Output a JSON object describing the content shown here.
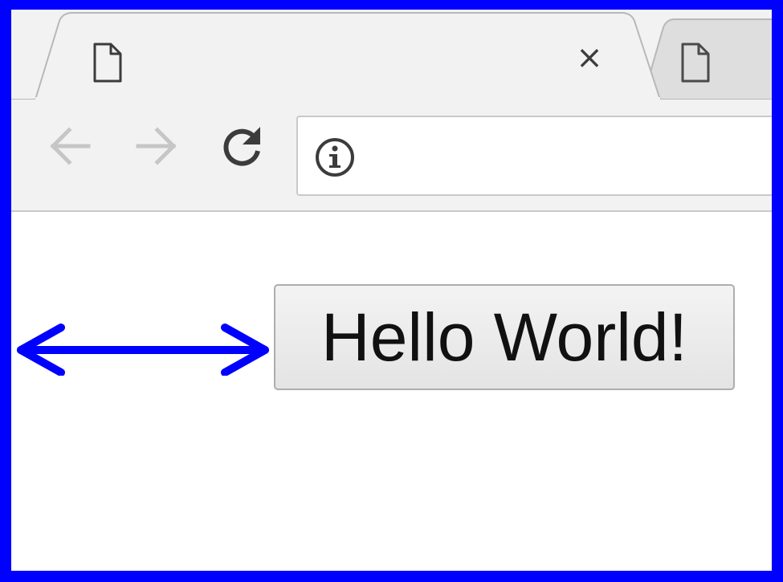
{
  "colors": {
    "frame_border": "#0000ff",
    "arrow": "#0000ff",
    "chrome_bg": "#f2f2f2",
    "inactive_tab": "#dedede",
    "disabled_nav": "#c6c6c6",
    "active_icon": "#3c3c3c"
  },
  "tabs": [
    {
      "icon": "page-icon",
      "active": true,
      "close_label": "×"
    },
    {
      "icon": "page-icon",
      "active": false
    }
  ],
  "toolbar": {
    "back_icon": "arrow-left-icon",
    "forward_icon": "arrow-right-icon",
    "reload_icon": "reload-icon",
    "back_enabled": false,
    "forward_enabled": false
  },
  "omnibox": {
    "icon": "info-icon",
    "value": "",
    "placeholder": ""
  },
  "page": {
    "button_label": "Hello World!"
  },
  "annotation": {
    "icon": "double-headed-arrow"
  }
}
